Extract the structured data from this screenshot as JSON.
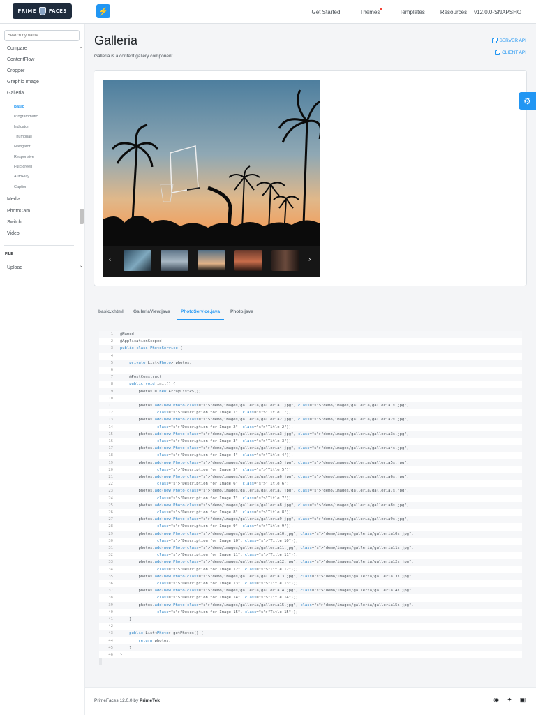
{
  "topbar": {
    "logo_text": "PRIME FACES",
    "menu_icon": "bolt-icon",
    "nav": [
      "Get Started",
      "Themes",
      "Templates",
      "Resources",
      "v12.0.0-SNAPSHOT"
    ]
  },
  "sidebar": {
    "search_placeholder": "Search by name...",
    "items": [
      "Compare",
      "ContentFlow",
      "Cropper",
      "Graphic Image",
      "Galleria"
    ],
    "galleria_subitems": [
      "Basic",
      "Programmatic",
      "Indicator",
      "Thumbnail",
      "Navigator",
      "Responsive",
      "FullScreen",
      "AutoPlay",
      "Caption"
    ],
    "items_after": [
      "Media",
      "PhotoCam",
      "Switch",
      "Video"
    ],
    "category_file": "FILE",
    "file_items": [
      "Upload"
    ]
  },
  "page": {
    "title": "Galleria",
    "subtitle": "Galleria is a content gallery component.",
    "server_api": "SERVER API",
    "client_api": "CLIENT API"
  },
  "tabs": [
    "basic.xhtml",
    "GalleriaView.java",
    "PhotoService.java",
    "Photo.java"
  ],
  "active_tab": "PhotoService.java",
  "code_lines": [
    "@Named",
    "@ApplicationScoped",
    "public class PhotoService {",
    "",
    "    private List<Photo> photos;",
    "",
    "    @PostConstruct",
    "    public void init() {",
    "        photos = new ArrayList<>();",
    "",
    "        photos.add(new Photo(\"demo/images/galleria/galleria1.jpg\", \"demo/images/galleria/galleria1s.jpg\",",
    "                \"Description for Image 1\", \"Title 1\"));",
    "        photos.add(new Photo(\"demo/images/galleria/galleria2.jpg\", \"demo/images/galleria/galleria2s.jpg\",",
    "                \"Description for Image 2\", \"Title 2\"));",
    "        photos.add(new Photo(\"demo/images/galleria/galleria3.jpg\", \"demo/images/galleria/galleria3s.jpg\",",
    "                \"Description for Image 3\", \"Title 3\"));",
    "        photos.add(new Photo(\"demo/images/galleria/galleria4.jpg\", \"demo/images/galleria/galleria4s.jpg\",",
    "                \"Description for Image 4\", \"Title 4\"));",
    "        photos.add(new Photo(\"demo/images/galleria/galleria5.jpg\", \"demo/images/galleria/galleria5s.jpg\",",
    "                \"Description for Image 5\", \"Title 5\"));",
    "        photos.add(new Photo(\"demo/images/galleria/galleria6.jpg\", \"demo/images/galleria/galleria6s.jpg\",",
    "                \"Description for Image 6\", \"Title 6\"));",
    "        photos.add(new Photo(\"demo/images/galleria/galleria7.jpg\", \"demo/images/galleria/galleria7s.jpg\",",
    "                \"Description for Image 7\", \"Title 7\"));",
    "        photos.add(new Photo(\"demo/images/galleria/galleria8.jpg\", \"demo/images/galleria/galleria8s.jpg\",",
    "                \"Description for Image 8\", \"Title 8\"));",
    "        photos.add(new Photo(\"demo/images/galleria/galleria9.jpg\", \"demo/images/galleria/galleria9s.jpg\",",
    "                \"Description for Image 9\", \"Title 9\"));",
    "        photos.add(new Photo(\"demo/images/galleria/galleria10.jpg\", \"demo/images/galleria/galleria10s.jpg\",",
    "                \"Description for Image 10\", \"Title 10\"));",
    "        photos.add(new Photo(\"demo/images/galleria/galleria11.jpg\", \"demo/images/galleria/galleria11s.jpg\",",
    "                \"Description for Image 11\", \"Title 11\"));",
    "        photos.add(new Photo(\"demo/images/galleria/galleria12.jpg\", \"demo/images/galleria/galleria12s.jpg\",",
    "                \"Description for Image 12\", \"Title 12\"));",
    "        photos.add(new Photo(\"demo/images/galleria/galleria13.jpg\", \"demo/images/galleria/galleria13s.jpg\",",
    "                \"Description for Image 13\", \"Title 13\"));",
    "        photos.add(new Photo(\"demo/images/galleria/galleria14.jpg\", \"demo/images/galleria/galleria14s.jpg\",",
    "                \"Description for Image 14\", \"Title 14\"));",
    "        photos.add(new Photo(\"demo/images/galleria/galleria15.jpg\", \"demo/images/galleria/galleria15s.jpg\",",
    "                \"Description for Image 15\", \"Title 15\"));",
    "    }",
    "",
    "    public List<Photo> getPhotos() {",
    "        return photos;",
    "    }",
    "}"
  ],
  "footer": {
    "text_prefix": "PrimeFaces 12.0.0 by",
    "text_org": "PrimeTek",
    "icons": [
      "github-icon",
      "twitter-icon",
      "discord-icon"
    ]
  },
  "colors": {
    "accent": "#2196f3",
    "topbar_bg": "#ffffff",
    "page_bg": "#f4f5f7"
  }
}
